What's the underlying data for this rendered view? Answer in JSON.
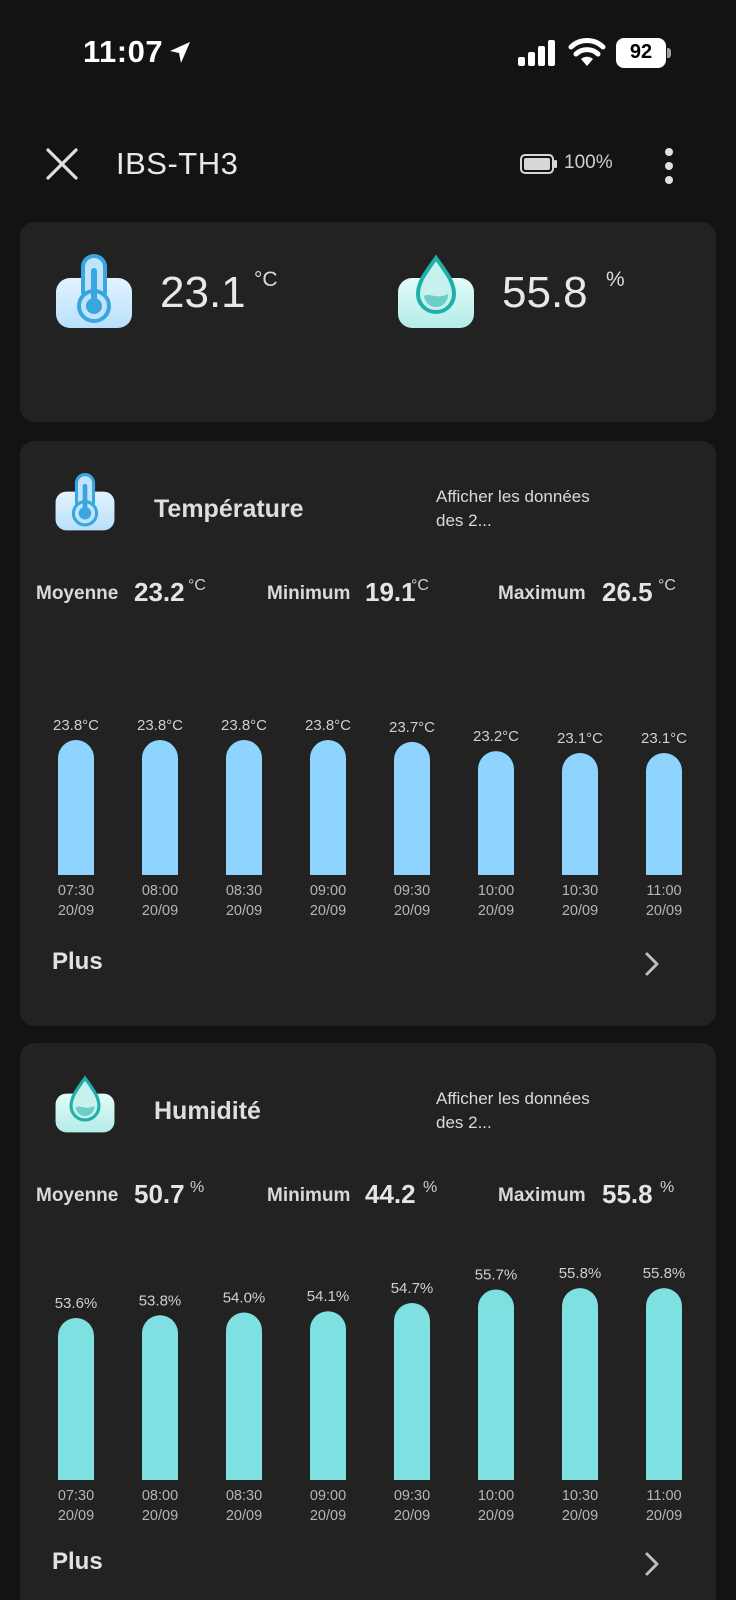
{
  "status_bar": {
    "time": "11:07",
    "battery": "92"
  },
  "header": {
    "title": "IBS-TH3",
    "battery_pct": "100%"
  },
  "current": {
    "temperature": {
      "value": "23.1",
      "unit": "°C"
    },
    "humidity": {
      "value": "55.8",
      "unit": "%"
    }
  },
  "temperature_section": {
    "title": "Température",
    "link": "Afficher les données des 2...",
    "stats": {
      "avg_label": "Moyenne",
      "avg_value": "23.2",
      "avg_unit": "°C",
      "min_label": "Minimum",
      "min_value": "19.1",
      "min_unit": "°C",
      "max_label": "Maximum",
      "max_value": "26.5",
      "max_unit": "°C"
    },
    "more": "Plus",
    "color": "#8fd3ff"
  },
  "humidity_section": {
    "title": "Humidité",
    "link": "Afficher les données des 2...",
    "stats": {
      "avg_label": "Moyenne",
      "avg_value": "50.7",
      "avg_unit": "%",
      "min_label": "Minimum",
      "min_value": "44.2",
      "min_unit": "%",
      "max_label": "Maximum",
      "max_value": "55.8",
      "max_unit": "%"
    },
    "more": "Plus",
    "color": "#7ee0e0"
  },
  "chart_data": [
    {
      "type": "bar",
      "categories": [
        "07:30 20/09",
        "08:00 20/09",
        "08:30 20/09",
        "09:00 20/09",
        "09:30 20/09",
        "10:00 20/09",
        "10:30 20/09",
        "11:00 20/09"
      ],
      "values": [
        23.8,
        23.8,
        23.8,
        23.8,
        23.7,
        23.2,
        23.1,
        23.1
      ],
      "data_labels": [
        "23.8°C",
        "23.8°C",
        "23.8°C",
        "23.8°C",
        "23.7°C",
        "23.2°C",
        "23.1°C",
        "23.1°C"
      ],
      "unit": "°C"
    },
    {
      "type": "bar",
      "categories": [
        "07:30 20/09",
        "08:00 20/09",
        "08:30 20/09",
        "09:00 20/09",
        "09:30 20/09",
        "10:00 20/09",
        "10:30 20/09",
        "11:00 20/09"
      ],
      "values": [
        53.6,
        53.8,
        54.0,
        54.1,
        54.7,
        55.7,
        55.8,
        55.8
      ],
      "data_labels": [
        "53.6%",
        "53.8%",
        "54.0%",
        "54.1%",
        "54.7%",
        "55.7%",
        "55.8%",
        "55.8%"
      ],
      "unit": "%"
    }
  ]
}
